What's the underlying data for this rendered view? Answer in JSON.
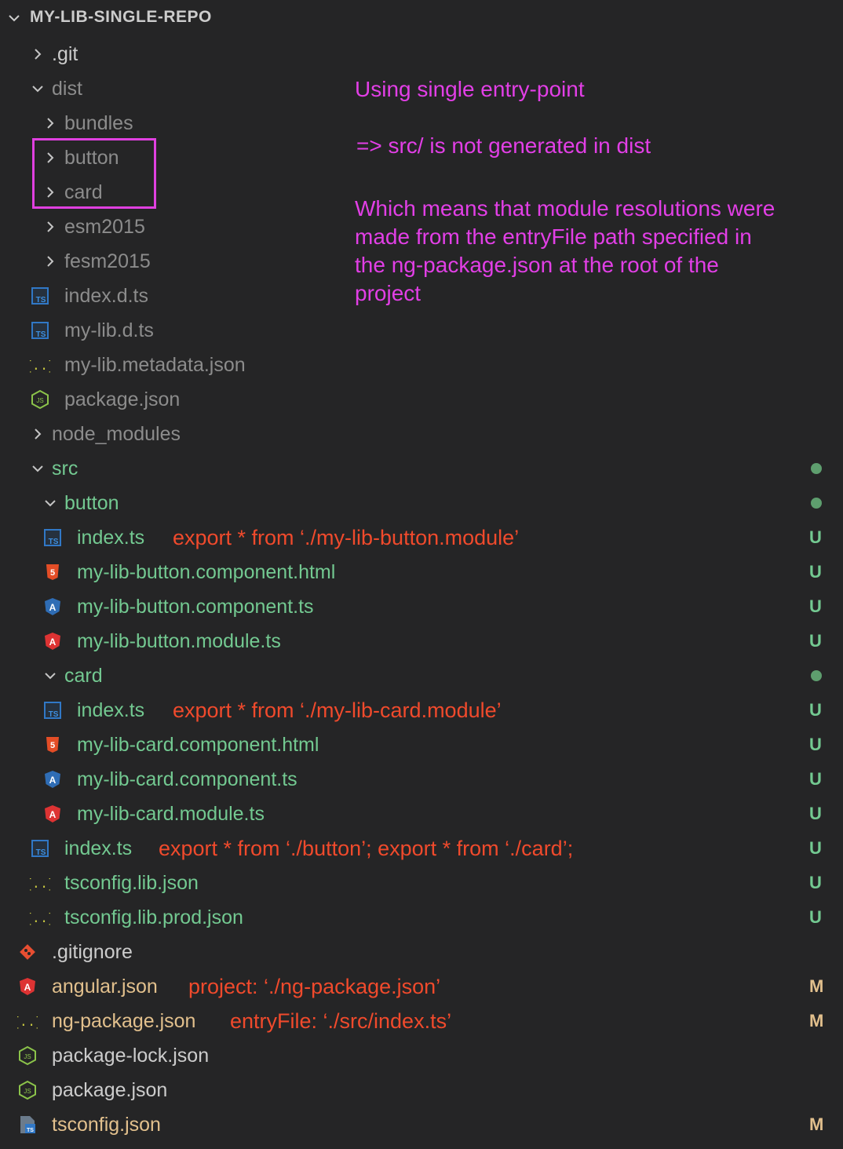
{
  "explorer": {
    "title": "MY-LIB-SINGLE-REPO",
    "rows": [
      {
        "label": ".git",
        "note": "",
        "badge": "",
        "dot": false
      },
      {
        "label": "dist",
        "note": "",
        "badge": "",
        "dot": false
      },
      {
        "label": "bundles",
        "note": "",
        "badge": "",
        "dot": false
      },
      {
        "label": "button",
        "note": "",
        "badge": "",
        "dot": false
      },
      {
        "label": "card",
        "note": "",
        "badge": "",
        "dot": false
      },
      {
        "label": "esm2015",
        "note": "",
        "badge": "",
        "dot": false
      },
      {
        "label": "fesm2015",
        "note": "",
        "badge": "",
        "dot": false
      },
      {
        "label": "index.d.ts",
        "note": "",
        "badge": "",
        "dot": false
      },
      {
        "label": "my-lib.d.ts",
        "note": "",
        "badge": "",
        "dot": false
      },
      {
        "label": "my-lib.metadata.json",
        "note": "",
        "badge": "",
        "dot": false
      },
      {
        "label": "package.json",
        "note": "",
        "badge": "",
        "dot": false
      },
      {
        "label": "node_modules",
        "note": "",
        "badge": "",
        "dot": false
      },
      {
        "label": "src",
        "note": "",
        "badge": "",
        "dot": true
      },
      {
        "label": "button",
        "note": "",
        "badge": "",
        "dot": true
      },
      {
        "label": "index.ts",
        "note": "export * from ‘./my-lib-button.module’",
        "badge": "U",
        "dot": false
      },
      {
        "label": "my-lib-button.component.html",
        "note": "",
        "badge": "U",
        "dot": false
      },
      {
        "label": "my-lib-button.component.ts",
        "note": "",
        "badge": "U",
        "dot": false
      },
      {
        "label": "my-lib-button.module.ts",
        "note": "",
        "badge": "U",
        "dot": false
      },
      {
        "label": "card",
        "note": "",
        "badge": "",
        "dot": true
      },
      {
        "label": "index.ts",
        "note": "export * from ‘./my-lib-card.module’",
        "badge": "U",
        "dot": false
      },
      {
        "label": "my-lib-card.component.html",
        "note": "",
        "badge": "U",
        "dot": false
      },
      {
        "label": "my-lib-card.component.ts",
        "note": "",
        "badge": "U",
        "dot": false
      },
      {
        "label": "my-lib-card.module.ts",
        "note": "",
        "badge": "U",
        "dot": false
      },
      {
        "label": "index.ts",
        "note": "export * from ‘./button’; export * from ‘./card’;",
        "badge": "U",
        "dot": false
      },
      {
        "label": "tsconfig.lib.json",
        "note": "",
        "badge": "U",
        "dot": false
      },
      {
        "label": "tsconfig.lib.prod.json",
        "note": "",
        "badge": "U",
        "dot": false
      },
      {
        "label": ".gitignore",
        "note": "",
        "badge": "",
        "dot": false
      },
      {
        "label": "angular.json",
        "note": "project: ‘./ng-package.json’",
        "badge": "M",
        "dot": false
      },
      {
        "label": "ng-package.json",
        "note": "entryFile: ‘./src/index.ts’",
        "badge": "M",
        "dot": false
      },
      {
        "label": "package-lock.json",
        "note": "",
        "badge": "",
        "dot": false
      },
      {
        "label": "package.json",
        "note": "",
        "badge": "",
        "dot": false
      },
      {
        "label": "tsconfig.json",
        "note": "",
        "badge": "M",
        "dot": false
      }
    ]
  },
  "annotation": {
    "line1": "Using single entry-point",
    "line2": "=> src/ is not generated in dist",
    "line3": "Which means that module resolutions were made from the entryFile path specified in the ng-package.json at the root of the project"
  },
  "colors": {
    "background": "#252526",
    "annotation": "#e23fe6",
    "note": "#f04a2c",
    "untracked": "#73c991",
    "modified": "#e2c08d"
  }
}
